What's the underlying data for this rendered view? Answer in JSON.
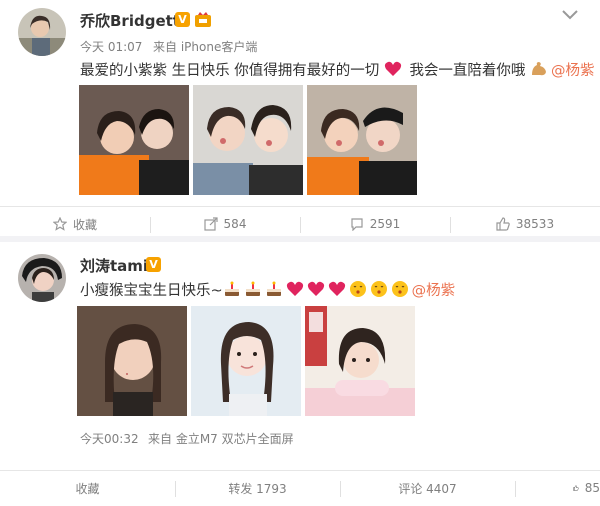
{
  "post1": {
    "username": "乔欣Bridgette",
    "verified_badge": "V",
    "time": "今天 01:07",
    "source": "来自 iPhone客户端",
    "text_part1": "最爱的小紫紫 生日快乐 你值得拥有最好的一切",
    "text_part2": "我会一直陪着你哦",
    "mention": "@杨紫",
    "actions": {
      "favorite": "收藏",
      "repost": "584",
      "comment": "2591",
      "like": "38533"
    }
  },
  "post2": {
    "username": "刘涛tamia",
    "verified_badge": "V",
    "text_part1": "小瘦猴宝宝生日快乐~",
    "mention": "@杨紫",
    "time": "今天00:32",
    "source": "来自 金立M7 双芯片全面屏",
    "actions": {
      "favorite": "收藏",
      "repost": "转发 1793",
      "comment": "评论 4407",
      "like": "85"
    }
  },
  "icons": {
    "heart_emoji": "red-heart",
    "muscle_emoji": "flexed-biceps",
    "cake_emoji": "birthday-cake",
    "kiss_emoji": "kissing-face"
  },
  "colors": {
    "mention": "#eb7350",
    "verified": "#f7a200",
    "heart": "#e0245e"
  }
}
